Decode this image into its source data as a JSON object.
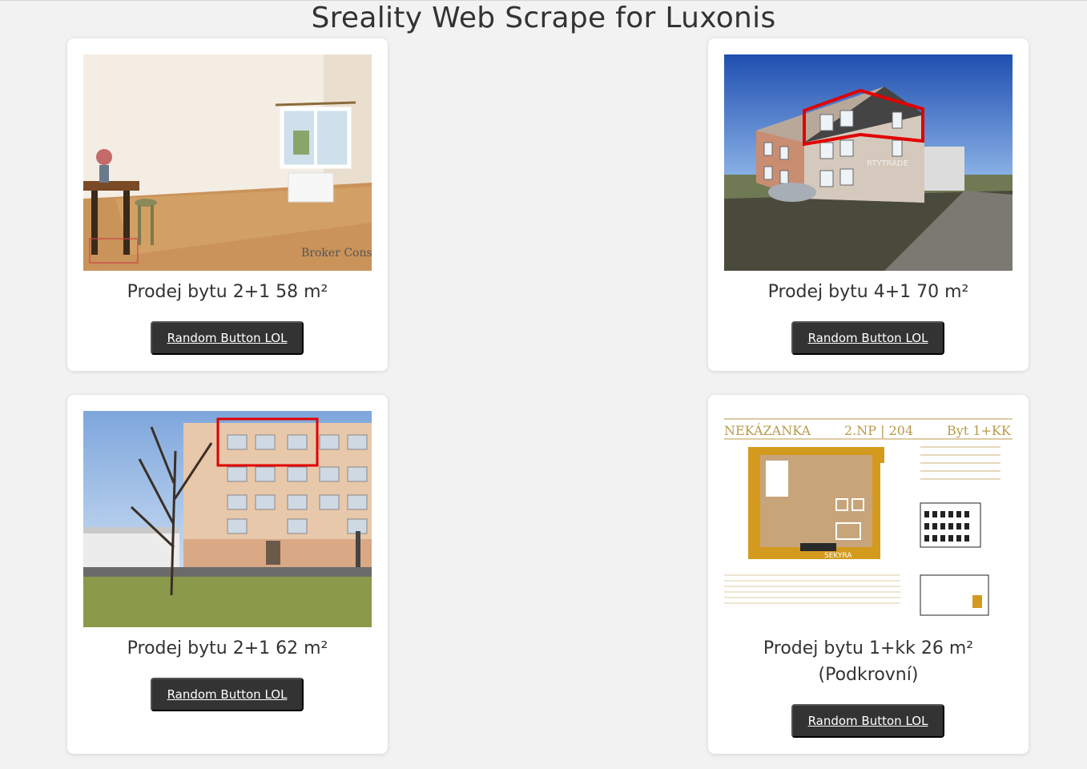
{
  "page": {
    "title": "Sreality Web Scrape for Luxonis"
  },
  "listings": [
    {
      "title": "Prodej bytu 2+1 58 m²",
      "button": "Random Button LOL",
      "photo_watermark": "Broker Consulting"
    },
    {
      "title": "Prodej bytu 4+1 70 m²",
      "button": "Random Button LOL"
    },
    {
      "title": "Prodej bytu 2+1 62 m²",
      "button": "Random Button LOL"
    },
    {
      "title_line1": "Prodej bytu 1+kk 26 m²",
      "title_line2": "(Podkrovní)",
      "button": "Random Button LOL",
      "plan": {
        "name": "NEKÁZANKA",
        "floor": "2.NP | 204",
        "type": "Byt 1+KK"
      }
    }
  ]
}
